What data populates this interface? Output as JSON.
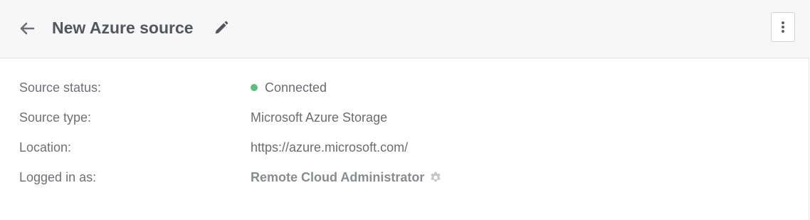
{
  "header": {
    "title": "New Azure source",
    "back_icon": "arrow-left-icon",
    "edit_icon": "pencil-icon",
    "menu_icon": "vertical-ellipsis-icon"
  },
  "details": {
    "rows": [
      {
        "label": "Source status:",
        "value": "Connected",
        "status_color": "#5cbf7e"
      },
      {
        "label": "Source type:",
        "value": "Microsoft Azure Storage"
      },
      {
        "label": "Location:",
        "value": "https://azure.microsoft.com/"
      },
      {
        "label": "Logged in as:",
        "value": "Remote Cloud Administrator",
        "icon": "gear-icon"
      }
    ]
  },
  "colors": {
    "header_bg": "#f7f7f8",
    "text": "#55565a",
    "connected": "#5cbf7e"
  }
}
